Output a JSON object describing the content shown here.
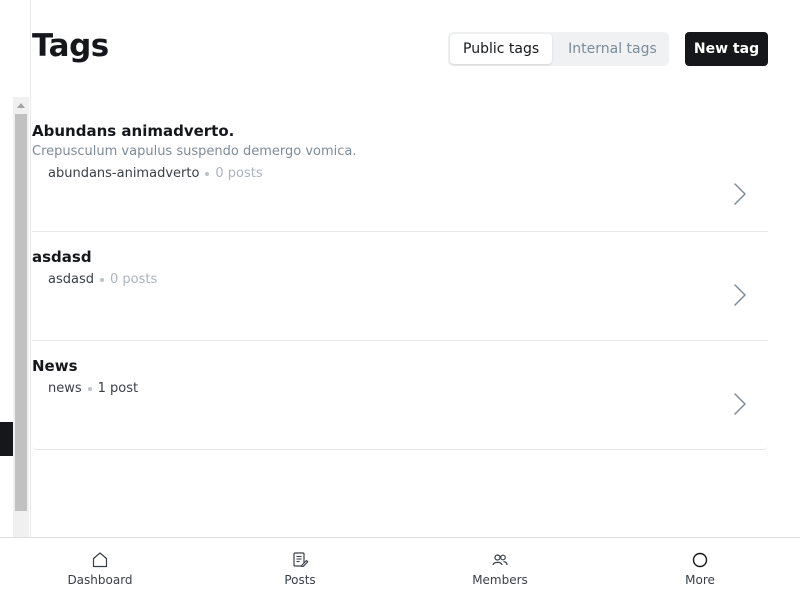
{
  "header": {
    "title": "Tags",
    "tabs": [
      {
        "label": "Public tags",
        "active": true
      },
      {
        "label": "Internal tags",
        "active": false
      }
    ],
    "new_tag_label": "New tag"
  },
  "tags": [
    {
      "name": "Abundans animadverto.",
      "description": "Crepusculum vapulus suspendo demergo vomica.",
      "slug": "abundans-animadverto",
      "count": "0 posts"
    },
    {
      "name": "asdasd",
      "slug": "asdasd",
      "count": "0 posts"
    },
    {
      "name": "News",
      "slug": "news",
      "count": "1 post"
    }
  ],
  "bottom_nav": [
    {
      "label": "Dashboard",
      "icon": "home-icon"
    },
    {
      "label": "Posts",
      "icon": "posts-icon"
    },
    {
      "label": "Members",
      "icon": "members-icon"
    },
    {
      "label": "More",
      "icon": "more-circle-icon"
    }
  ],
  "colors": {
    "primary_dark": "#15171a",
    "muted_text": "#7c8b9a",
    "divider": "#e6e9eb",
    "tab_background": "#eff1f2"
  }
}
